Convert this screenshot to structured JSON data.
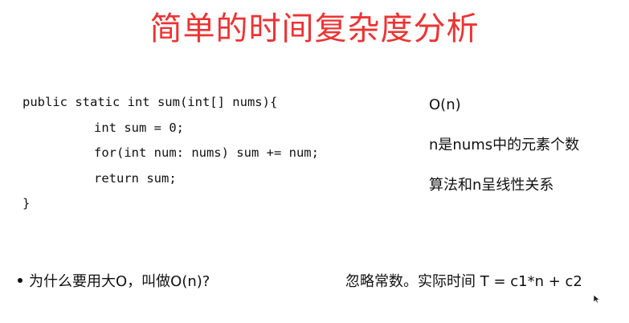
{
  "slide": {
    "title": "简单的时间复杂度分析",
    "title_color": "#ee3333",
    "code_lines": [
      "public static int sum(int[] nums){",
      "int sum = 0;",
      "for(int num: nums) sum += num;",
      "return sum;",
      "}"
    ],
    "notes": [
      "O(n)",
      "n是nums中的元素个数",
      "算法和n呈线性关系"
    ],
    "bullet": "为什么要用大O，叫做O(n)?",
    "explanation": "忽略常数。实际时间 T = c1*n + c2"
  }
}
